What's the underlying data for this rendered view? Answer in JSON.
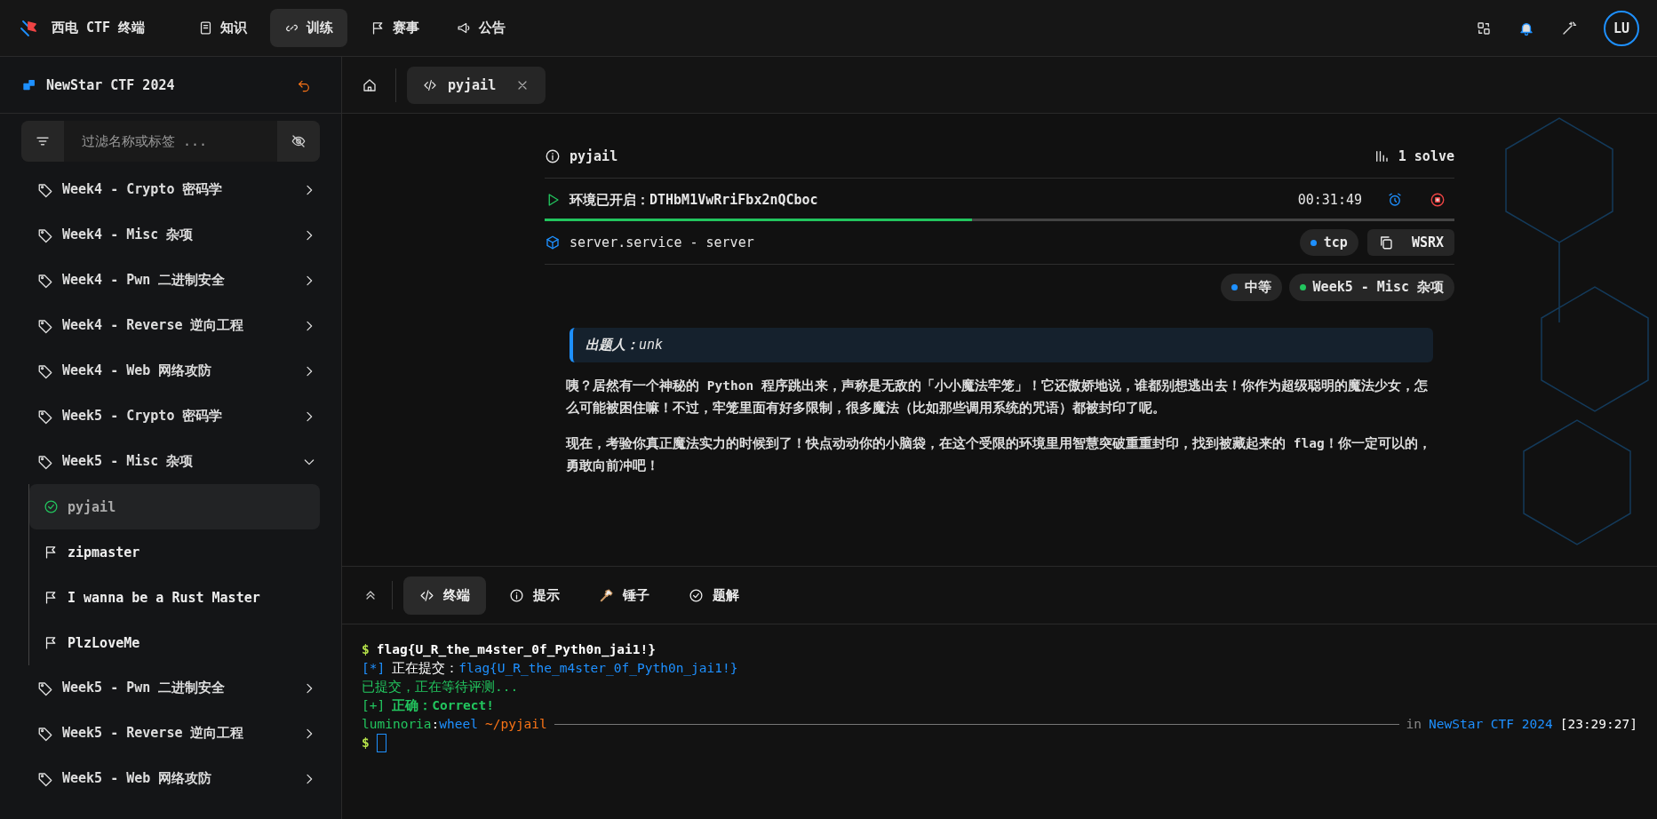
{
  "top_nav": {
    "brand": "西电 CTF 终端",
    "avatar": "LU",
    "items": [
      {
        "label": "知识",
        "selected": false
      },
      {
        "label": "训练",
        "selected": true
      },
      {
        "label": "赛事",
        "selected": false
      },
      {
        "label": "公告",
        "selected": false
      }
    ]
  },
  "sidebar": {
    "title": "NewStar CTF 2024",
    "filter": {
      "placeholder": "过滤名称或标签 ..."
    },
    "categories": [
      {
        "label": "Week4 - Crypto 密码学",
        "expanded": false
      },
      {
        "label": "Week4 - Misc 杂项",
        "expanded": false
      },
      {
        "label": "Week4 - Pwn 二进制安全",
        "expanded": false
      },
      {
        "label": "Week4 - Reverse 逆向工程",
        "expanded": false
      },
      {
        "label": "Week4 - Web 网络攻防",
        "expanded": false
      },
      {
        "label": "Week5 - Crypto 密码学",
        "expanded": false
      },
      {
        "label": "Week5 - Misc 杂项",
        "expanded": true,
        "children": [
          {
            "label": "pyjail",
            "selected": true,
            "solved": true
          },
          {
            "label": "zipmaster",
            "selected": false,
            "solved": false
          },
          {
            "label": "I wanna be a Rust Master",
            "selected": false,
            "solved": false
          },
          {
            "label": "PlzLoveMe",
            "selected": false,
            "solved": false
          }
        ]
      },
      {
        "label": "Week5 - Pwn 二进制安全",
        "expanded": false
      },
      {
        "label": "Week5 - Reverse 逆向工程",
        "expanded": false
      },
      {
        "label": "Week5 - Web 网络攻防",
        "expanded": false
      }
    ]
  },
  "tabs": [
    {
      "label": "pyjail",
      "selected": true
    }
  ],
  "challenge": {
    "title": "pyjail",
    "solves": "1 solve",
    "env": {
      "label": "环境已开启：DTHbM1VwRriFbx2nQCboc",
      "time": "00:31:49",
      "level": 0.47
    },
    "service": {
      "name": "server.service - server",
      "protocol": "tcp",
      "action": "WSRX"
    },
    "tags": [
      {
        "label": "中等",
        "color": "#1e90ff"
      },
      {
        "label": "Week5 - Misc 杂项",
        "color": "#22c55e"
      }
    ],
    "author": "**出题人：**unk",
    "paragraphs": [
      "咦？居然有一个神秘的 Python 程序跳出来，声称是无敌的「小小魔法牢笼」！它还傲娇地说，谁都别想逃出去！你作为超级聪明的魔法少女，怎么可能被困住嘛！不过，牢笼里面有好多限制，很多魔法（比如那些调用系统的咒语）都被封印了呢。",
      "现在，考验你真正魔法实力的时候到了！快点动动你的小脑袋，在这个受限的环境里用智慧突破重重封印，找到被藏起来的 flag！你一定可以的，勇敢向前冲吧！"
    ]
  },
  "bottom_tabs": [
    {
      "label": "终端",
      "selected": true,
      "kind": "code"
    },
    {
      "label": "提示",
      "selected": false,
      "kind": "info"
    },
    {
      "label": "锤子",
      "selected": false,
      "kind": "hammer"
    },
    {
      "label": "题解",
      "selected": false,
      "kind": "check"
    }
  ],
  "terminal": {
    "lines": [
      {
        "kind": "command",
        "prompt": "$",
        "text": "flag{U_R_the_m4ster_0f_Pyth0n_jai1!}"
      },
      {
        "kind": "info",
        "prefix": "[*]",
        "label": "正在提交：",
        "text": "flag{U_R_the_m4ster_0f_Pyth0n_jai1!}"
      },
      {
        "kind": "status",
        "text": "已提交，正在等待评测..."
      },
      {
        "kind": "success",
        "prefix": "[+]",
        "label": "正确：",
        "text": "Correct!"
      },
      {
        "kind": "context",
        "user": "luminoria",
        "sep": ":",
        "host": "wheel",
        "path": "~/pyjail",
        "suffix": "in",
        "project": "NewStar CTF 2024",
        "time": "[23:29:27]"
      },
      {
        "kind": "input",
        "prompt": "$"
      }
    ]
  }
}
